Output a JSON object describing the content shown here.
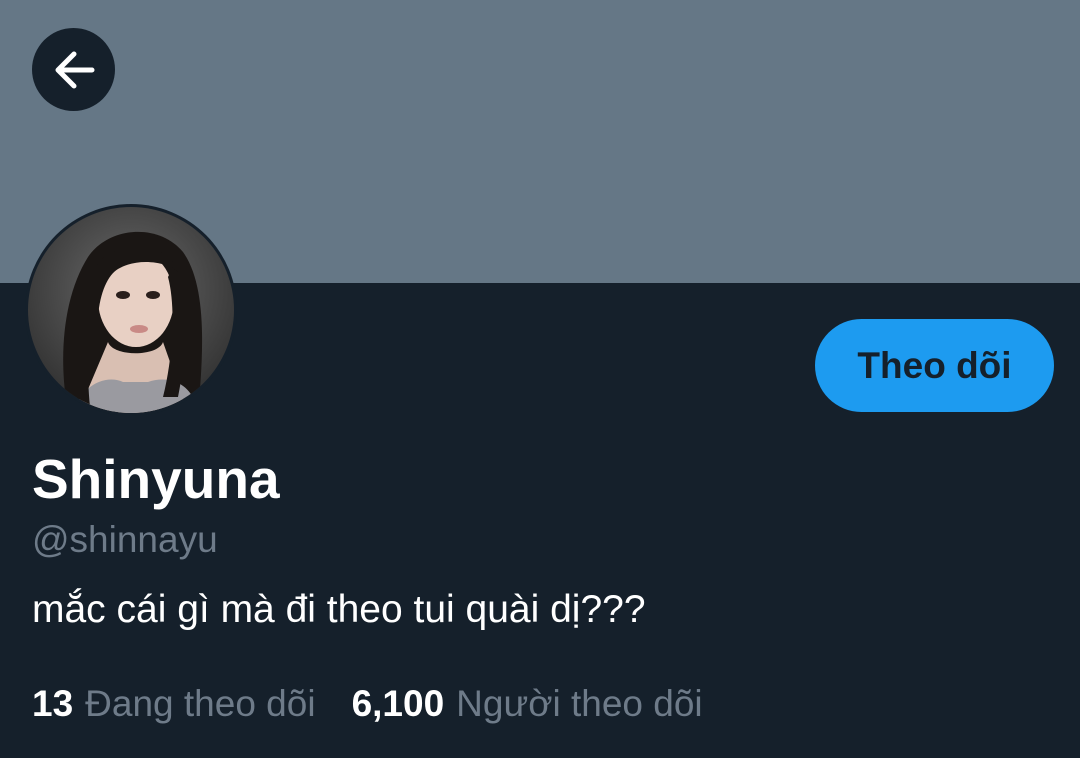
{
  "header": {
    "back_icon": "arrow-left-icon",
    "banner_color": "#657786"
  },
  "profile": {
    "display_name": "Shinyuna",
    "handle": "@shinnayu",
    "bio": "mắc cái gì mà đi theo tui quài dị???",
    "follow_button_label": "Theo dõi",
    "avatar_alt": "avatar"
  },
  "stats": {
    "following_count": "13",
    "following_label": "Đang theo dõi",
    "followers_count": "6,100",
    "followers_label": "Người theo dõi"
  },
  "colors": {
    "background": "#15202b",
    "accent": "#1d9bf0",
    "secondary_text": "#6e7b89"
  }
}
